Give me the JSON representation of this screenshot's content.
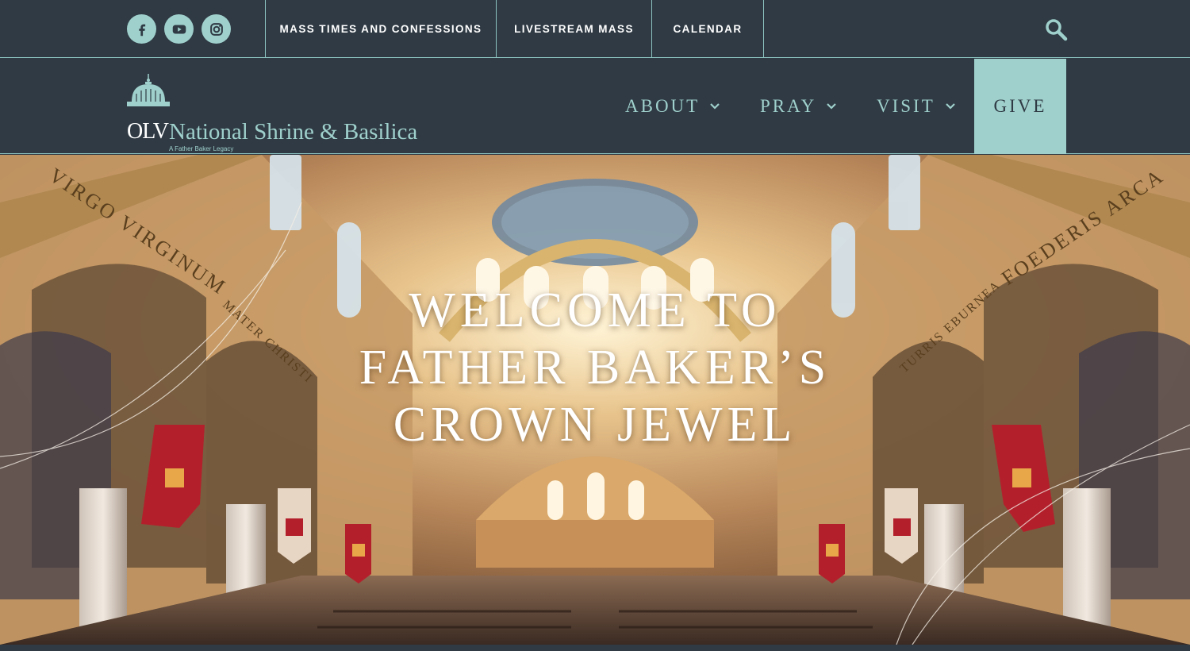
{
  "social": [
    {
      "icon": "facebook-icon",
      "label": "Facebook"
    },
    {
      "icon": "youtube-icon",
      "label": "YouTube"
    },
    {
      "icon": "instagram-icon",
      "label": "Instagram"
    }
  ],
  "topnav": {
    "mass_times": "MASS TIMES AND CONFESSIONS",
    "livestream": "LIVESTREAM MASS",
    "calendar": "CALENDAR"
  },
  "logo": {
    "olv": "OLV",
    "name": "National Shrine & Basilica",
    "tagline": "A Father Baker Legacy"
  },
  "mainnav": {
    "about": "ABOUT",
    "pray": "PRAY",
    "visit": "VISIT",
    "give": "GIVE"
  },
  "hero": {
    "line1": "WELCOME TO",
    "line2": "FATHER BAKER’S",
    "line3": "CROWN JEWEL",
    "left_inscription": "VIRGO VIRGINUM",
    "left_inscription2": "MATER CHRISTI",
    "right_inscription": "FOEDERIS ARCA",
    "right_inscription2": "TURRIS EBURNEA"
  },
  "colors": {
    "navy": "#2f3a44",
    "teal": "#9fd0cc",
    "banner_red": "#b3202c"
  }
}
